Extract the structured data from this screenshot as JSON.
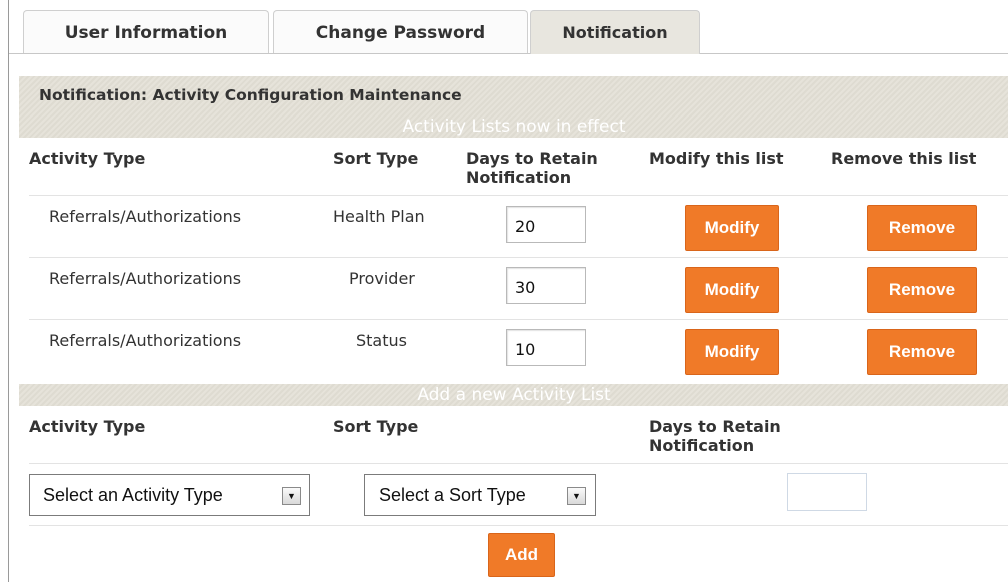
{
  "tabs": [
    {
      "label": "User Information"
    },
    {
      "label": "Change Password"
    },
    {
      "label": "Notification"
    }
  ],
  "section_title": "Notification: Activity Configuration Maintenance",
  "current_lists": {
    "banner": "Activity Lists now in effect",
    "headers": {
      "activity_type": "Activity Type",
      "sort_type": "Sort Type",
      "days_line1": "Days to Retain",
      "days_line2": "Notification",
      "modify": "Modify this list",
      "remove": "Remove this list"
    },
    "rows": [
      {
        "activity_type": "Referrals/Authorizations",
        "sort_type": "Health Plan",
        "days": "20",
        "modify_label": "Modify",
        "remove_label": "Remove"
      },
      {
        "activity_type": "Referrals/Authorizations",
        "sort_type": "Provider",
        "days": "30",
        "modify_label": "Modify",
        "remove_label": "Remove"
      },
      {
        "activity_type": "Referrals/Authorizations",
        "sort_type": "Status",
        "days": "10",
        "modify_label": "Modify",
        "remove_label": "Remove"
      }
    ]
  },
  "new_list": {
    "banner": "Add a new Activity List",
    "headers": {
      "activity_type": "Activity Type",
      "sort_type": "Sort Type",
      "days_line1": "Days to Retain",
      "days_line2": "Notification"
    },
    "activity_select": "Select an Activity Type",
    "sort_select": "Select a Sort Type",
    "days_value": "",
    "add_label": "Add"
  },
  "colors": {
    "accent_orange": "#f07a28",
    "band_gray": "#e3e0d7"
  }
}
